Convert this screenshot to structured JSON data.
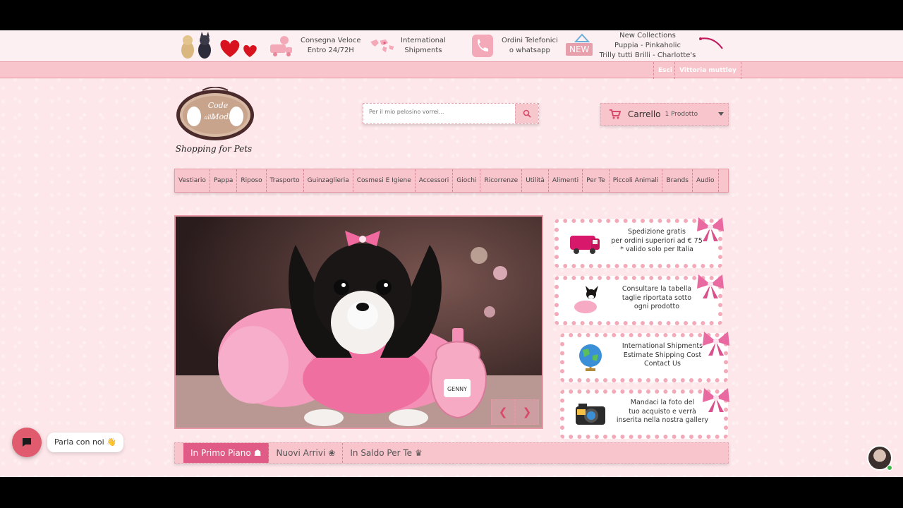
{
  "infobar": {
    "delivery": {
      "line1": "Consegna Veloce",
      "line2": "Entro 24/72H"
    },
    "international": {
      "line1": "International",
      "line2": "Shipments"
    },
    "phone": {
      "line1": "Ordini Telefonici",
      "line2": "o whatsapp"
    },
    "new_badge": "NEW",
    "collections": {
      "line1": "New Collections",
      "line2": "Puppia - Pinkaholic",
      "line3": "Trilly tutti Brilli - Charlotte's Dress"
    }
  },
  "userbar": {
    "link1": "Esci",
    "link2": "Vittoria muttley"
  },
  "logo": {
    "line1": "Code",
    "line2": "alla",
    "line3": "Moda",
    "tagline": "Shopping for Pets"
  },
  "search": {
    "placeholder": "Per il mio pelosino vorrei..."
  },
  "cart": {
    "title": "Carrello",
    "count": "1 Prodotto"
  },
  "nav": [
    "Vestiario",
    "Pappa",
    "Riposo",
    "Trasporto",
    "Guinzaglieria",
    "Cosmesi E Igiene",
    "Accessori",
    "Giochi",
    "Ricorrenze",
    "Utilità",
    "Alimenti",
    "Per Te",
    "Piccoli Animali",
    "Brands",
    "Audio"
  ],
  "slider": {
    "perfume_label": "GENNY"
  },
  "banners": [
    {
      "line1": "Spedizione gratis",
      "line2": "per ordini superiori ad € 75",
      "line3": "* valido solo per Italia"
    },
    {
      "line1": "Consultare la tabella",
      "line2": "taglie riportata sotto",
      "line3": "ogni prodotto"
    },
    {
      "line1": "International Shipments",
      "line2": "Estimate Shipping Cost",
      "line3": "Contact Us"
    },
    {
      "line1": "Mandaci la foto del",
      "line2": "tuo acquisto e verrà",
      "line3": "inserita nella nostra gallery"
    }
  ],
  "tabs": [
    "In Primo Piano",
    "Nuovi Arrivi",
    "In Saldo Per Te"
  ],
  "chat": {
    "label": "Parla con noi 👋"
  },
  "colors": {
    "accent": "#e05b86",
    "bar": "#f8c5cc",
    "page": "#fde7ea",
    "chat": "#e05b6d"
  }
}
